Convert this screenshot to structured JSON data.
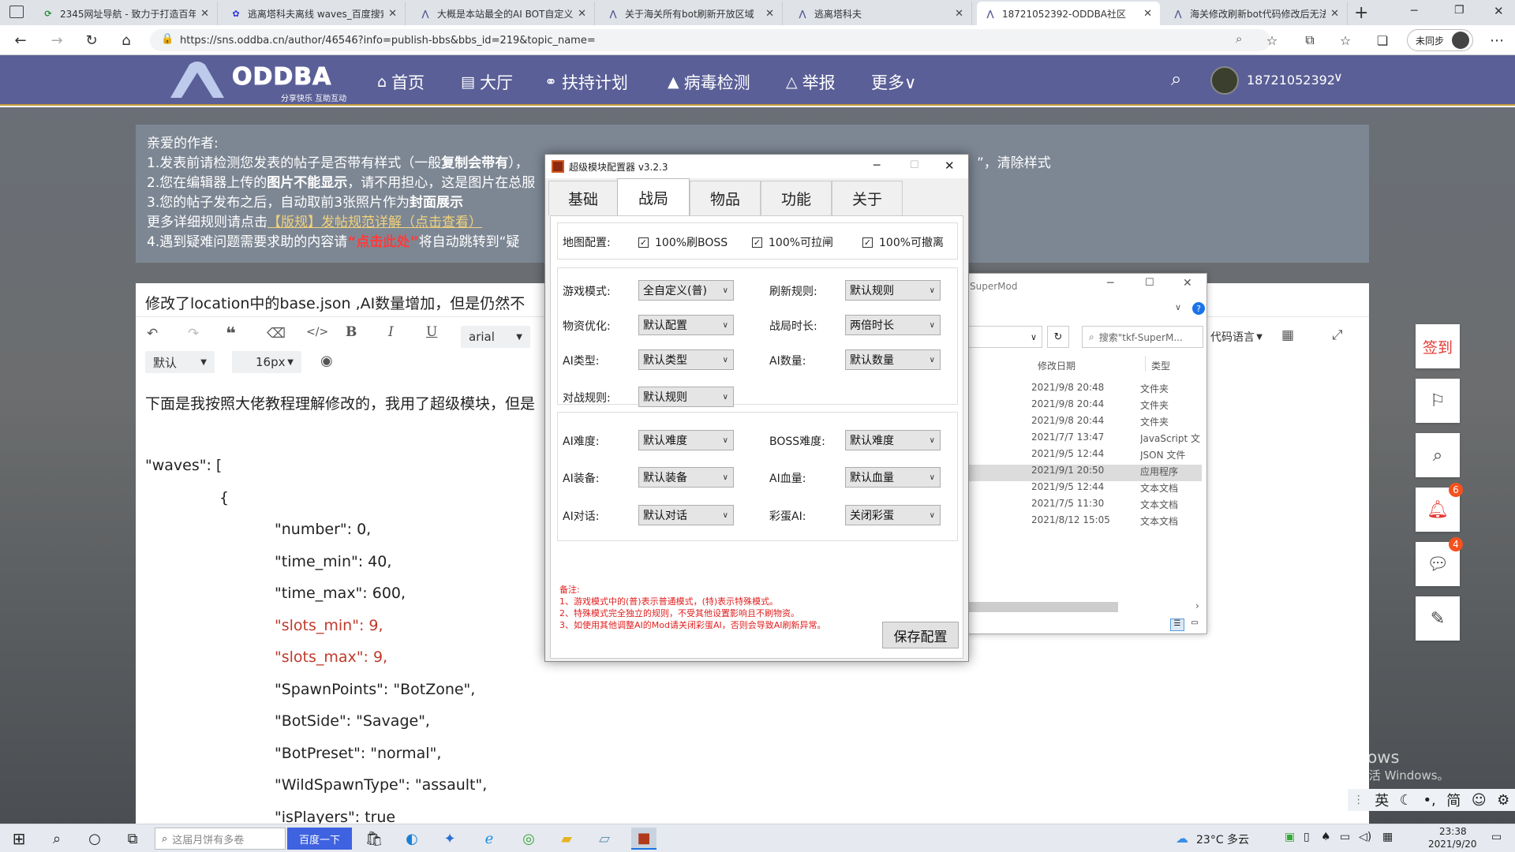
{
  "browser": {
    "tabs": [
      {
        "title": "2345网址导航 - 致力于打造百年",
        "active": false
      },
      {
        "title": "逃离塔科夫离线 waves_百度搜索",
        "active": false
      },
      {
        "title": "大概是本站最全的AI BOT自定义",
        "active": false
      },
      {
        "title": "关于海关所有bot刷新开放区域",
        "active": false
      },
      {
        "title": "逃离塔科夫",
        "active": false
      },
      {
        "title": "18721052392-ODDBA社区",
        "active": true
      },
      {
        "title": "海关修改刷新bot代码修改后无法",
        "active": false
      }
    ],
    "url": "https://sns.oddba.cn/author/46546?info=publish-bbs&bbs_id=219&topic_name=",
    "profile_label": "未同步"
  },
  "site": {
    "logo_text": "ODDBA",
    "logo_sub": "分享快乐 互助互动",
    "nav": [
      {
        "label": "首页",
        "icon": "home-icon"
      },
      {
        "label": "大厅",
        "icon": "hall-icon"
      },
      {
        "label": "扶持计划",
        "icon": "handshake-icon"
      },
      {
        "label": "病毒检测",
        "icon": "warning-icon"
      },
      {
        "label": "举报",
        "icon": "report-icon"
      },
      {
        "label": "更多∨",
        "icon": ""
      }
    ],
    "username": "18721052392"
  },
  "notice": {
    "greeting": "亲爱的作者:",
    "line1_pre": "1.发表前请检测您发表的帖子是否带有样式（一般",
    "line1_bold": "复制会带有",
    "line1_post": "），",
    "line1_tail": "”，清除样式",
    "line2_pre": "2.您在编辑器上传的",
    "line2_bold": "图片不能显示",
    "line2_post": "，请不用担心，这是图片在总服",
    "line3_pre": "3.您的帖子发布之后，自动取前3张照片作为",
    "line3_bold": "封面展示",
    "line4_pre": "更多详细规则请点击",
    "line4_link": "【版规】发帖规范详解（点击查看）",
    "line5_pre": "4.遇到疑难问题需要求助的内容请",
    "line5_red": "“点击此处”",
    "line5_post": "将自动跳转到“疑"
  },
  "editor": {
    "title": "修改了location中的base.json ,AI数量增加，但是仍然不",
    "font_name": "arial",
    "style_default": "默认",
    "font_size": "16px",
    "code_lang": "代码语言",
    "body_intro": "下面是我按照大佬教程理解修改的，我用了超级模块，但是",
    "code_lines": [
      {
        "text": "\"waves\": [",
        "indent": 0,
        "red": false
      },
      {
        "text": "{",
        "indent": 1,
        "red": false
      },
      {
        "text": "\"number\": 0,",
        "indent": 2,
        "red": false
      },
      {
        "text": "\"time_min\": 40,",
        "indent": 2,
        "red": false
      },
      {
        "text": "\"time_max\": 600,",
        "indent": 2,
        "red": false
      },
      {
        "text": "\"slots_min\": 9,",
        "indent": 2,
        "red": true
      },
      {
        "text": "\"slots_max\": 9,",
        "indent": 2,
        "red": true
      },
      {
        "text": "\"SpawnPoints\": \"BotZone\",",
        "indent": 2,
        "red": false
      },
      {
        "text": "\"BotSide\": \"Savage\",",
        "indent": 2,
        "red": false
      },
      {
        "text": "\"BotPreset\": \"normal\",",
        "indent": 2,
        "red": false
      },
      {
        "text": "\"WildSpawnType\": \"assault\",",
        "indent": 2,
        "red": false
      },
      {
        "text": "\"isPlayers\": true",
        "indent": 2,
        "red": false
      }
    ]
  },
  "sidebar": {
    "checkin_label": "签到",
    "notify_badge": "6",
    "message_badge": "4"
  },
  "explorer": {
    "title": "SuperMod",
    "search_placeholder": "搜索\"tkf-SuperM...",
    "col_date": "修改日期",
    "col_type": "类型",
    "rows": [
      {
        "date": "2021/9/8 20:48",
        "type": "文件夹"
      },
      {
        "date": "2021/9/8 20:44",
        "type": "文件夹"
      },
      {
        "date": "2021/9/8 20:44",
        "type": "文件夹"
      },
      {
        "date": "2021/7/7 13:47",
        "type": "JavaScript 文"
      },
      {
        "date": "2021/9/5 12:44",
        "type": "JSON 文件"
      },
      {
        "date": "2021/9/1 20:50",
        "type": "应用程序"
      },
      {
        "date": "2021/9/5 12:44",
        "type": "文本文档"
      },
      {
        "date": "2021/7/5 11:30",
        "type": "文本文档"
      },
      {
        "date": "2021/8/12 15:05",
        "type": "文本文档"
      }
    ]
  },
  "dialog": {
    "title": "超级模块配置器 v3.2.3",
    "tabs": [
      "基础",
      "战局",
      "物品",
      "功能",
      "关于"
    ],
    "active_tab": "战局",
    "map_config_label": "地图配置:",
    "checkboxes": [
      {
        "label": "100%刷BOSS",
        "checked": true
      },
      {
        "label": "100%可拉闸",
        "checked": true
      },
      {
        "label": "100%可撤离",
        "checked": true
      }
    ],
    "group1": {
      "game_mode_label": "游戏模式:",
      "game_mode": "全自定义(普)",
      "refresh_label": "刷新规则:",
      "refresh": "默认规则",
      "loot_label": "物资优化:",
      "loot": "默认配置",
      "duration_label": "战局时长:",
      "duration": "两倍时长",
      "ai_type_label": "AI类型:",
      "ai_type": "默认类型",
      "ai_count_label": "AI数量:",
      "ai_count": "默认数量",
      "pvp_label": "对战规则:",
      "pvp": "默认规则"
    },
    "group2": {
      "ai_diff_label": "AI难度:",
      "ai_diff": "默认难度",
      "boss_diff_label": "BOSS难度:",
      "boss_diff": "默认难度",
      "ai_gear_label": "AI装备:",
      "ai_gear": "默认装备",
      "ai_hp_label": "AI血量:",
      "ai_hp": "默认血量",
      "ai_talk_label": "AI对话:",
      "ai_talk": "默认对话",
      "egg_label": "彩蛋AI:",
      "egg": "关闭彩蛋"
    },
    "note_title": "备注:",
    "notes": [
      "1、游戏模式中的(普)表示普通模式，(特)表示特殊模式。",
      "2、特殊模式完全独立的规则，不受其他设置影响且不刷物资。",
      "3、如使用其他调整AI的Mod请关闭彩蛋AI，否则会导致AI刷新异常。"
    ],
    "save_label": "保存配置"
  },
  "watermark": {
    "line1": "激活 Windows",
    "line2": "转到\"设置\"以激活 Windows。"
  },
  "ime": {
    "lang": "英",
    "mode": "简"
  },
  "taskbar": {
    "search_placeholder": "这届月饼有多卷",
    "search_button": "百度一下",
    "weather": "23°C 多云",
    "time": "23:38",
    "date": "2021/9/20"
  }
}
